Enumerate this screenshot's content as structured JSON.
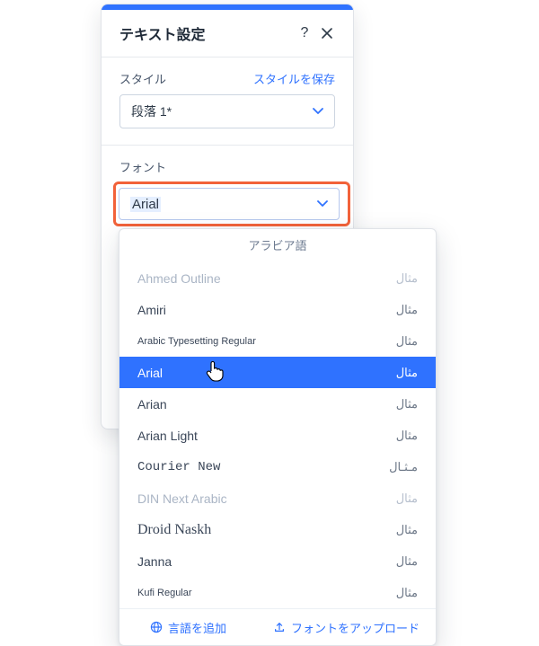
{
  "panel": {
    "title": "テキスト設定",
    "style_label": "スタイル",
    "save_style": "スタイルを保存",
    "style_value": "段落 1*",
    "font_label": "フォント",
    "font_value": "Arial"
  },
  "dropdown": {
    "group": "アラビア語",
    "items": [
      {
        "name": "Ahmed Outline",
        "sample": "مثال",
        "muted": true
      },
      {
        "name": "Amiri",
        "sample": "مثال"
      },
      {
        "name": "Arabic Typesetting Regular",
        "sample": "مثال",
        "small": true
      },
      {
        "name": "Arial",
        "sample": "مثال",
        "selected": true
      },
      {
        "name": "Arian",
        "sample": "مثال"
      },
      {
        "name": "Arian Light",
        "sample": "مثال"
      },
      {
        "name": "Courier New",
        "sample": "مـثـال",
        "mono": true
      },
      {
        "name": "DIN Next Arabic",
        "sample": "مثال",
        "muted": true
      },
      {
        "name": "Droid Naskh",
        "sample": "مثال",
        "serif": true
      },
      {
        "name": "Janna",
        "sample": "مثال"
      },
      {
        "name": "Kufi Regular",
        "sample": "مثال",
        "small": true
      }
    ],
    "add_lang": "言語を追加",
    "upload_font": "フォントをアップロード"
  }
}
